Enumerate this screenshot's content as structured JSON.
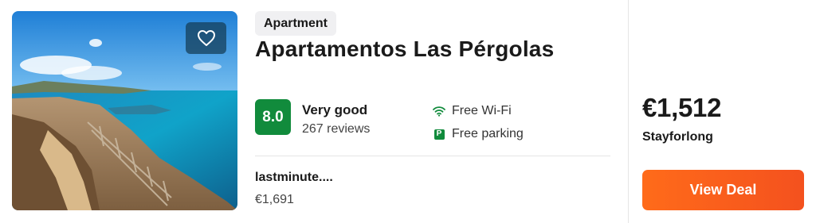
{
  "listing": {
    "type_badge": "Apartment",
    "name": "Apartamentos Las Pérgolas",
    "favorite_icon": "heart-outline-icon"
  },
  "rating": {
    "score": "8.0",
    "label": "Very good",
    "reviews": "267 reviews",
    "score_color": "#118b3c"
  },
  "amenities": [
    {
      "icon": "wifi-icon",
      "label": "Free Wi-Fi"
    },
    {
      "icon": "parking-icon",
      "icon_text": "P",
      "label": "Free parking"
    }
  ],
  "alternate_offer": {
    "provider": "lastminute....",
    "price": "€1,691"
  },
  "best_offer": {
    "price": "€1,512",
    "provider": "Stayforlong",
    "cta_label": "View Deal",
    "cta_color": "#f4511e"
  }
}
